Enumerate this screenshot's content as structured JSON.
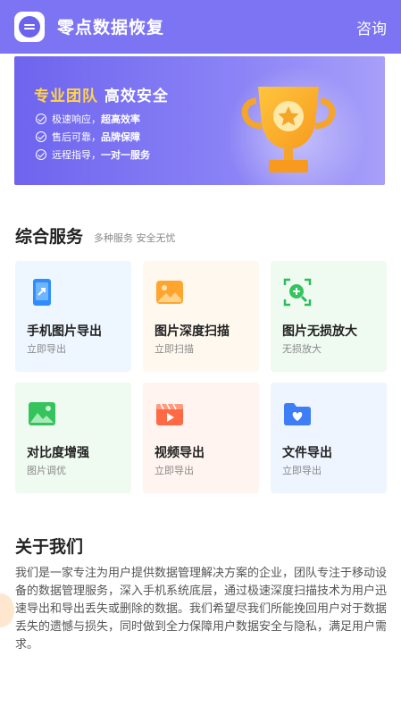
{
  "header": {
    "title": "零点数据恢复",
    "consult_label": "咨询"
  },
  "hero": {
    "headline_part1": "专业团队",
    "headline_part2": "高效安全",
    "items": [
      {
        "prefix": "极速响应，",
        "bold": "超高效率"
      },
      {
        "prefix": "售后可靠，",
        "bold": "品牌保障"
      },
      {
        "prefix": "远程指导，",
        "bold": "一对一服务"
      }
    ]
  },
  "services": {
    "title": "综合服务",
    "subtitle": "多种服务 安全无忧",
    "cards": [
      {
        "name": "手机图片导出",
        "action": "立即导出",
        "icon": "phone-export-icon"
      },
      {
        "name": "图片深度扫描",
        "action": "立即扫描",
        "icon": "image-scan-icon"
      },
      {
        "name": "图片无损放大",
        "action": "无损放大",
        "icon": "zoom-in-icon"
      },
      {
        "name": "对比度增强",
        "action": "图片调优",
        "icon": "landscape-icon"
      },
      {
        "name": "视频导出",
        "action": "立即导出",
        "icon": "video-icon"
      },
      {
        "name": "文件导出",
        "action": "立即导出",
        "icon": "folder-heart-icon"
      }
    ]
  },
  "about": {
    "title": "关于我们",
    "text": "我们是一家专注为用户提供数据管理解决方案的企业，团队专注于移动设备的数据管理服务，深入手机系统底层，通过极速深度扫描技术为用户迅速导出和导出丢失或删除的数据。我们希望尽我们所能挽回用户对于数据丢失的遗憾与损失，同时做到全力保障用户数据安全与隐私，满足用户需求。"
  },
  "colors": {
    "brand": "#7d74f3",
    "accent_yellow": "#ffd44a"
  }
}
